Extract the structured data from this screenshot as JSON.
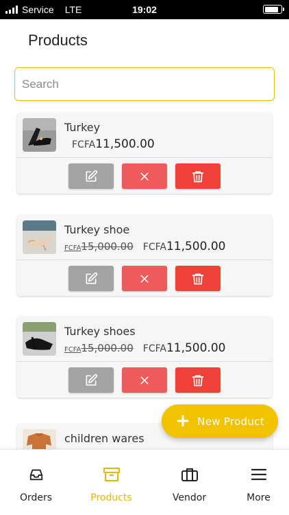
{
  "status_bar": {
    "carrier": "Service",
    "network": "LTE",
    "time": "19:02",
    "battery_level": 0.85
  },
  "page": {
    "title": "Products"
  },
  "search": {
    "placeholder": "Search",
    "value": ""
  },
  "products": [
    {
      "name": "Turkey",
      "old_currency": "",
      "old_price": "",
      "currency": "FCFA",
      "price": "11,500.00",
      "image_icon": "shoe-photo"
    },
    {
      "name": "Turkey shoe",
      "old_currency": "FCFA",
      "old_price": "15,000.00",
      "currency": "FCFA",
      "price": "11,500.00",
      "image_icon": "shoe-photo"
    },
    {
      "name": "Turkey shoes",
      "old_currency": "FCFA",
      "old_price": "15,000.00",
      "currency": "FCFA",
      "price": "11,500.00",
      "image_icon": "shoe-photo"
    },
    {
      "name": "children wares",
      "image_icon": "clothing-photo"
    }
  ],
  "fab": {
    "label": "New Product",
    "icon": "plus-icon"
  },
  "bottom_nav": [
    {
      "label": "Orders",
      "icon": "inbox-icon",
      "active": false
    },
    {
      "label": "Products",
      "icon": "archive-box-icon",
      "active": true
    },
    {
      "label": "Vendor",
      "icon": "briefcase-icon",
      "active": false
    },
    {
      "label": "More",
      "icon": "menu-icon",
      "active": false
    }
  ],
  "colors": {
    "accent": "#f0c200",
    "edit_button": "#a3a3a3",
    "cancel_button": "#ef5a5a",
    "delete_button": "#f04138",
    "active_nav": "#e6b800"
  }
}
